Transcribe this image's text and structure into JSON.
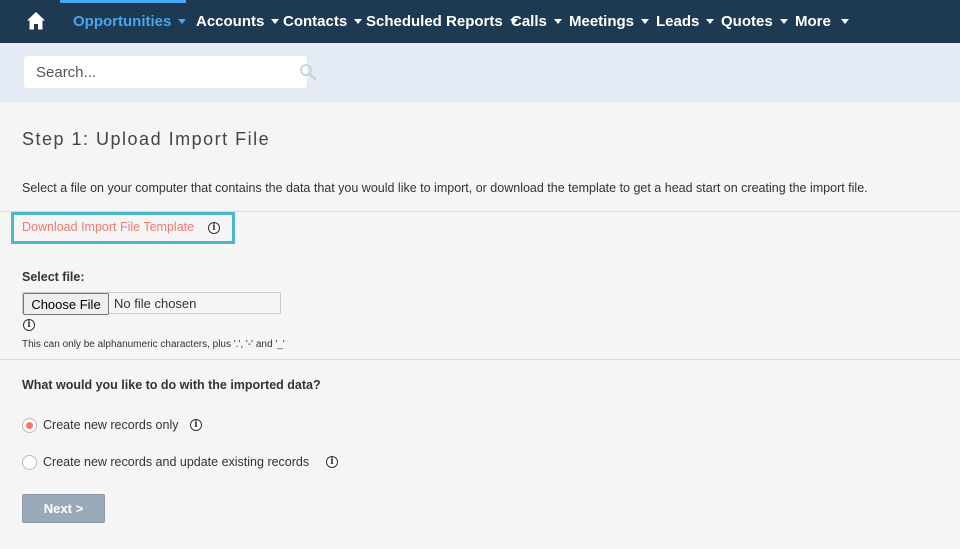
{
  "nav": {
    "items": [
      {
        "label": "Opportunities"
      },
      {
        "label": "Accounts"
      },
      {
        "label": "Contacts"
      },
      {
        "label": "Scheduled Reports"
      },
      {
        "label": "Calls"
      },
      {
        "label": "Meetings"
      },
      {
        "label": "Leads"
      },
      {
        "label": "Quotes"
      },
      {
        "label": "More"
      }
    ],
    "active_color": "#46a7f0",
    "background": "#1e3a52"
  },
  "search": {
    "placeholder": "Search...",
    "value": ""
  },
  "step": {
    "title": "Step 1: Upload Import File",
    "description": "Select a file on your computer that contains the data that you would like to import, or download the template to get a head start on creating the import file.",
    "template_link": "Download Import File Template"
  },
  "file": {
    "label": "Select file:",
    "button_label": "Choose File",
    "status": "No file chosen",
    "hint": "This can only be alphanumeric characters, plus '.', '-' and '_'"
  },
  "import_action": {
    "question": "What would you like to do with the imported data?",
    "options": [
      {
        "label": "Create new records only",
        "selected": true
      },
      {
        "label": "Create new records and update existing records",
        "selected": false
      }
    ]
  },
  "next_label": "Next >"
}
